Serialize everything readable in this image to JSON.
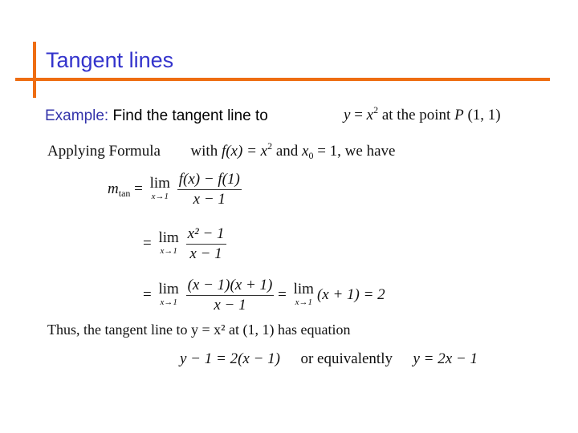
{
  "slide": {
    "title": "Tangent lines",
    "accent_color": "#ee6d12",
    "title_color": "#3333cc",
    "example_label": "Example:",
    "example_text": " Find the tangent line to",
    "problem": {
      "y": "y",
      "eq": " = ",
      "x": "x",
      "exp": "2",
      "rest": " at the point ",
      "P": "P",
      "point": " (1, 1)"
    },
    "applying": {
      "prefix": "Applying Formula",
      "with": "with ",
      "fx": "f",
      "fx_rest": "(x) = x",
      "exp": "2",
      "and": " and ",
      "x0": "x",
      "x0_sub": "0",
      "x0_rest": " = 1, we have"
    },
    "steps": [
      {
        "lhs": "m",
        "lhs_sub": "tan",
        "eq": " = ",
        "lim": "lim",
        "lim_sub": "x→1",
        "num": "f(x) − f(1)",
        "den": "x − 1"
      },
      {
        "eq": "= ",
        "lim": "lim",
        "lim_sub": "x→1",
        "num": "x² − 1",
        "den": "x − 1"
      },
      {
        "eq": "= ",
        "lim": "lim",
        "lim_sub": "x→1",
        "num": "(x − 1)(x + 1)",
        "den": "x − 1",
        "eq2": " = ",
        "lim2": "lim",
        "lim2_sub": "x→1",
        "after": "(x + 1) = 2"
      }
    ],
    "conclusion": "Thus, the tangent line to y = x² at (1, 1) has equation",
    "result": {
      "eq1": "y − 1 = 2(x − 1)",
      "or": "or equivalently",
      "eq2": "y = 2x − 1"
    }
  }
}
